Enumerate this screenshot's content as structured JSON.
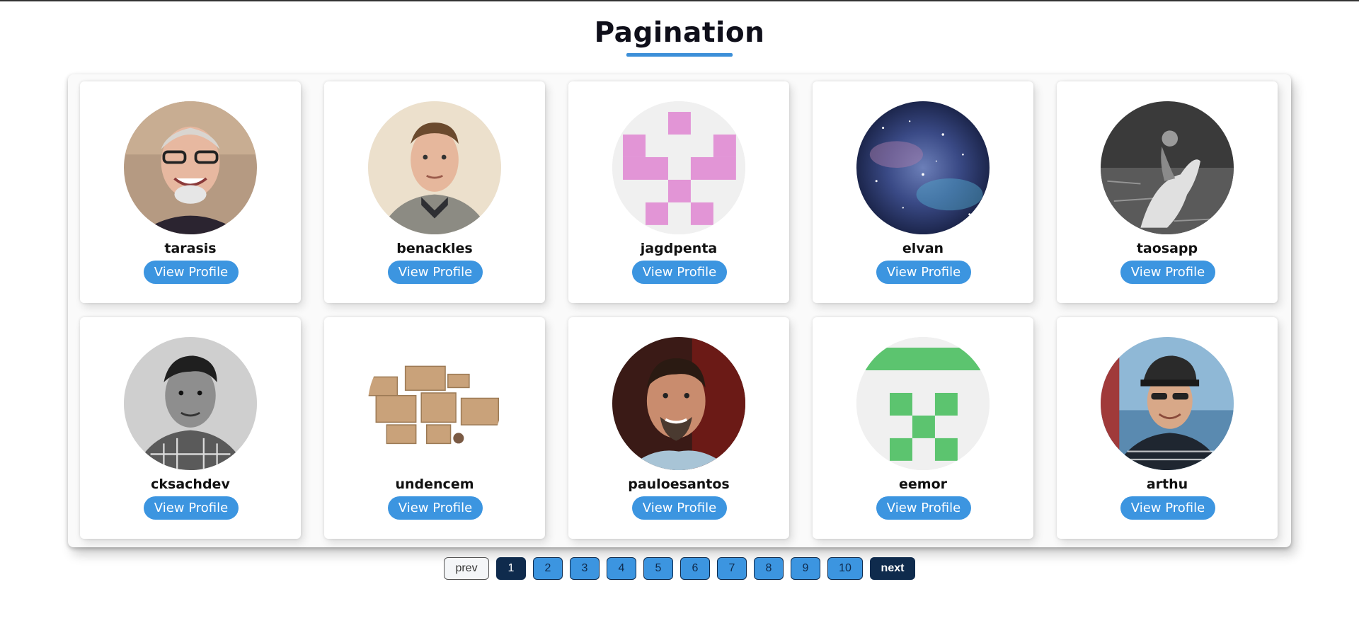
{
  "page": {
    "title": "Pagination",
    "accent": "#3c95e0",
    "dark": "#0f2b4d"
  },
  "cards": [
    {
      "username": "tarasis",
      "button": "View Profile",
      "avatar": "photo-man-glasses-avatar"
    },
    {
      "username": "benackles",
      "button": "View Profile",
      "avatar": "photo-man-avatar"
    },
    {
      "username": "jagdpenta",
      "button": "View Profile",
      "avatar": "identicon-pink-avatar"
    },
    {
      "username": "elvan",
      "button": "View Profile",
      "avatar": "galaxy-avatar"
    },
    {
      "username": "taosapp",
      "button": "View Profile",
      "avatar": "bw-horse-rider-avatar"
    },
    {
      "username": "cksachdev",
      "button": "View Profile",
      "avatar": "bw-photo-man-avatar"
    },
    {
      "username": "undencem",
      "button": "View Profile",
      "avatar": "boxes-avatar"
    },
    {
      "username": "pauloesantos",
      "button": "View Profile",
      "avatar": "photo-man-smiling-avatar"
    },
    {
      "username": "eemor",
      "button": "View Profile",
      "avatar": "identicon-green-avatar"
    },
    {
      "username": "arthu",
      "button": "View Profile",
      "avatar": "photo-man-cap-avatar"
    }
  ],
  "pagination": {
    "prev": "prev",
    "next": "next",
    "pages": [
      "1",
      "2",
      "3",
      "4",
      "5",
      "6",
      "7",
      "8",
      "9",
      "10"
    ],
    "current": "1"
  }
}
